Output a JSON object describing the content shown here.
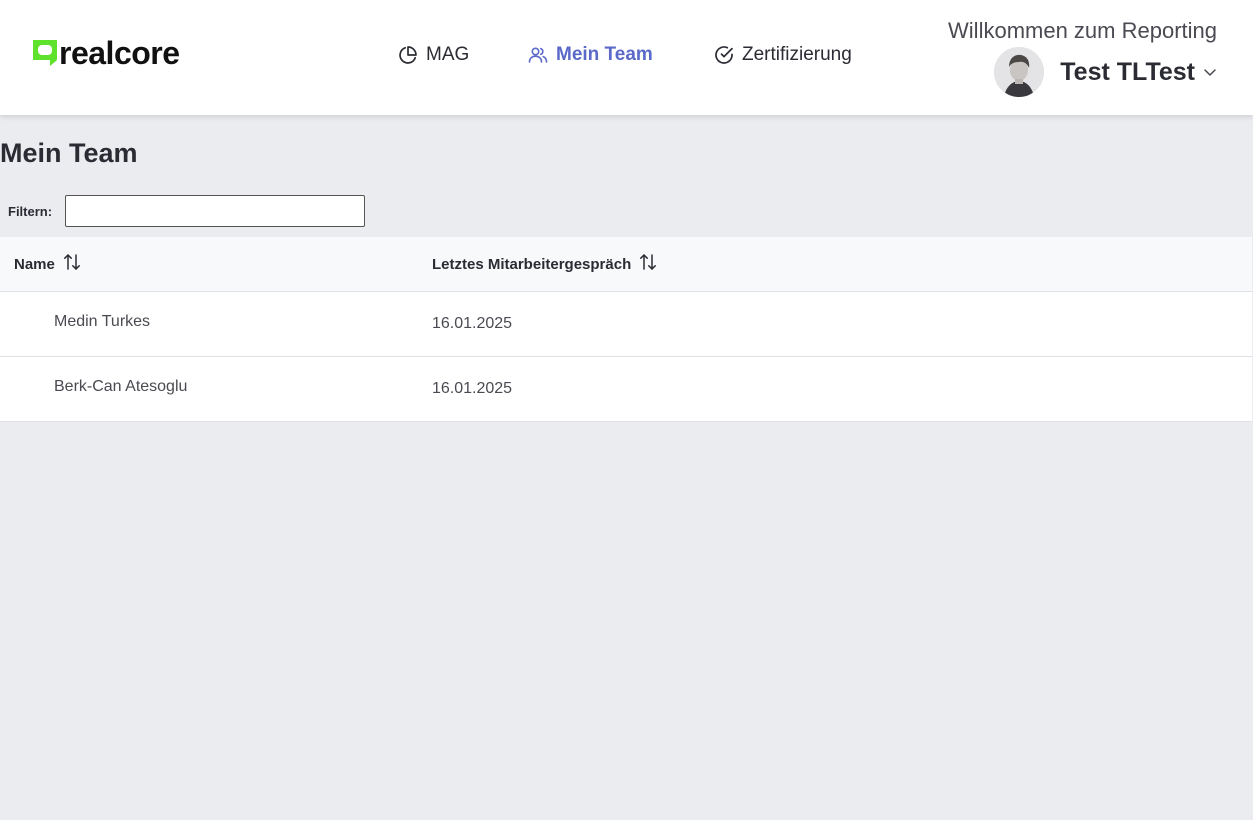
{
  "header": {
    "logo_text": "realcore",
    "brand_color": "#5ee22b",
    "welcome_text": "Willkommen zum Reporting",
    "user_name": "Test TLTest",
    "nav": [
      {
        "label": "MAG",
        "icon": "pie-chart-icon",
        "active": false
      },
      {
        "label": "Mein Team",
        "icon": "users-icon",
        "active": true
      },
      {
        "label": "Zertifizierung",
        "icon": "check-circle-icon",
        "active": false
      }
    ],
    "active_color": "#5b69c9"
  },
  "main": {
    "title": "Mein Team",
    "filter": {
      "label": "Filtern:",
      "value": ""
    },
    "table": {
      "columns": [
        "Name",
        "Letztes Mitarbeitergespräch"
      ],
      "rows": [
        [
          "Medin Turkes",
          "16.01.2025"
        ],
        [
          "Berk-Can Atesoglu",
          "16.01.2025"
        ]
      ]
    }
  }
}
